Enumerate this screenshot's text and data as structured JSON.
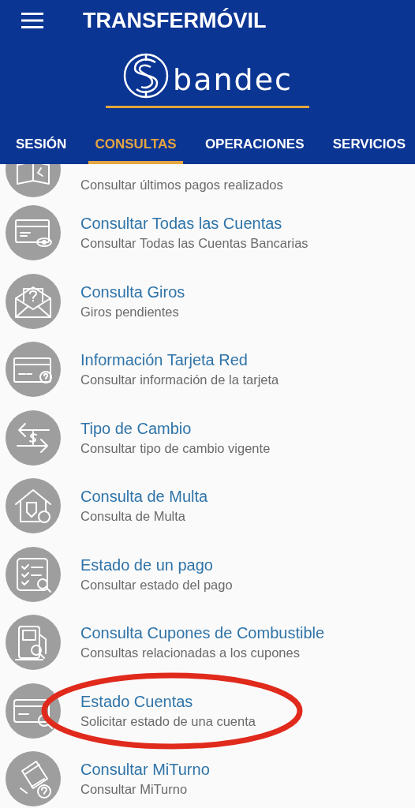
{
  "app_bar": {
    "title": "TRANSFERMÓVIL"
  },
  "logo": {
    "text": "bandec"
  },
  "tabs": [
    {
      "label": "SESIÓN",
      "selected": false
    },
    {
      "label": "CONSULTAS",
      "selected": true
    },
    {
      "label": "OPERACIONES",
      "selected": false
    },
    {
      "label": "SERVICIOS",
      "selected": false
    }
  ],
  "menu_items": [
    {
      "subtitle": "Consultar últimos pagos realizados",
      "highlighted": false
    },
    {
      "title": "Consultar Todas las Cuentas",
      "subtitle": "Consultar Todas las Cuentas Bancarias",
      "highlighted": false
    },
    {
      "title": "Consulta Giros",
      "subtitle": "Giros pendientes",
      "highlighted": false
    },
    {
      "title": "Información Tarjeta Red",
      "subtitle": "Consultar información de la tarjeta",
      "highlighted": false
    },
    {
      "title": "Tipo de Cambio",
      "subtitle": "Consultar tipo de cambio vigente",
      "highlighted": false
    },
    {
      "title": "Consulta de Multa",
      "subtitle": "Consulta de Multa",
      "highlighted": false
    },
    {
      "title": "Estado de un pago",
      "subtitle": "Consultar estado del pago",
      "highlighted": false
    },
    {
      "title": "Consulta Cupones de Combustible",
      "subtitle": "Consultas relacionadas a los cupones",
      "highlighted": false
    },
    {
      "title": "Estado Cuentas",
      "subtitle": "Solicitar estado de una cuenta",
      "highlighted": true
    },
    {
      "title": "Consultar MiTurno",
      "subtitle": "Consultar MiTurno",
      "highlighted": false
    }
  ]
}
